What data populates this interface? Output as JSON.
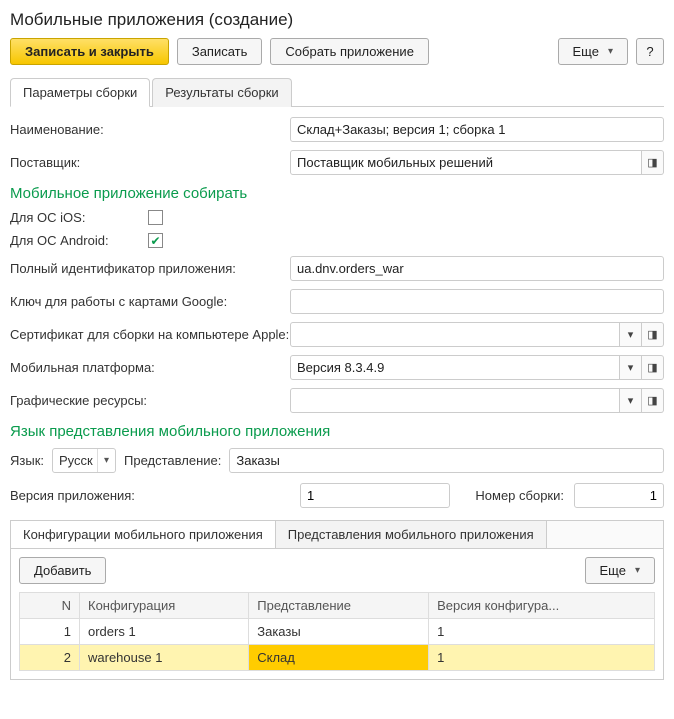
{
  "title": "Мобильные приложения (создание)",
  "toolbar": {
    "save_close": "Записать и закрыть",
    "save": "Записать",
    "build": "Собрать приложение",
    "more": "Еще",
    "help": "?"
  },
  "tabs": {
    "params": "Параметры сборки",
    "results": "Результаты сборки"
  },
  "fields": {
    "name_label": "Наименование:",
    "name_value": "Склад+Заказы; версия 1; сборка 1",
    "vendor_label": "Поставщик:",
    "vendor_value": "Поставщик мобильных решений",
    "build_section": "Мобильное приложение собирать",
    "ios_label": "Для ОС iOS:",
    "android_label": "Для ОС Android:",
    "appid_label": "Полный идентификатор приложения:",
    "appid_value": "ua.dnv.orders_war",
    "gkey_label": "Ключ для работы с картами Google:",
    "gkey_value": "",
    "applecert_label": "Сертификат для сборки на компьютере Apple:",
    "applecert_value": "",
    "platform_label": "Мобильная платформа:",
    "platform_value": "Версия 8.3.4.9",
    "graphics_label": "Графические ресурсы:",
    "graphics_value": "",
    "lang_section": "Язык представления мобильного приложения",
    "lang_label": "Язык:",
    "lang_value": "Русск",
    "repr_label": "Представление:",
    "repr_value": "Заказы",
    "version_label": "Версия приложения:",
    "version_value": "1",
    "buildno_label": "Номер сборки:",
    "buildno_value": "1"
  },
  "inner_tabs": {
    "configs": "Конфигурации мобильного приложения",
    "reprs": "Представления мобильного приложения",
    "add": "Добавить",
    "more": "Еще"
  },
  "grid": {
    "headers": {
      "n": "N",
      "config": "Конфигурация",
      "repr": "Представление",
      "ver": "Версия конфигура..."
    },
    "rows": [
      {
        "n": "1",
        "config": "orders 1",
        "repr": "Заказы",
        "ver": "1"
      },
      {
        "n": "2",
        "config": "warehouse 1",
        "repr": "Склад",
        "ver": "1"
      }
    ]
  }
}
